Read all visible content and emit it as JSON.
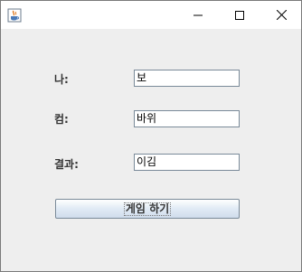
{
  "window": {
    "icon": "java-cup-icon",
    "controls": [
      "minimize-icon",
      "maximize-icon",
      "close-icon"
    ]
  },
  "form": {
    "player": {
      "label": "나:",
      "value": "보"
    },
    "computer": {
      "label": "컴:",
      "value": "바위"
    },
    "result": {
      "label": "결과:",
      "value": "이김"
    }
  },
  "play_button_label": "게임 하기"
}
